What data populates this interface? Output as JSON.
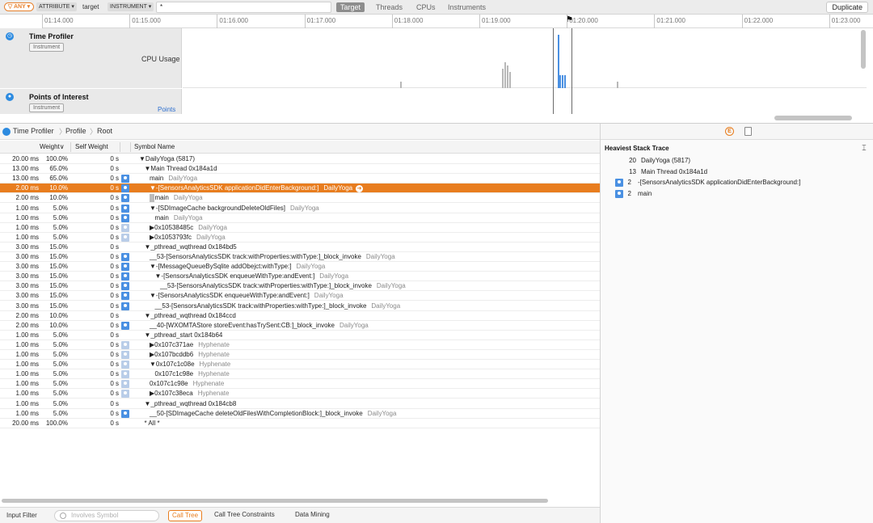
{
  "filterbar": {
    "any_label": "▽ ANY ▾",
    "token1": "ATTRIBUTE ▾",
    "token1_value": "target",
    "token2": "INSTRUMENT ▾",
    "token2_value": "*",
    "scopes": [
      "Target",
      "Threads",
      "CPUs",
      "Instruments"
    ],
    "active_scope": "Target",
    "duplicate_label": "Duplicate"
  },
  "ruler": {
    "ticks": [
      "01:14.000",
      "01:15.000",
      "01:16.000",
      "01:17.000",
      "01:18.000",
      "01:19.000",
      "01:20.000",
      "01:21.000",
      "01:22.000",
      "01:23.000"
    ]
  },
  "tracks": [
    {
      "title": "Time Profiler",
      "badge": "Instrument",
      "sub": "CPU Usage",
      "icon": "time-profiler-icon"
    },
    {
      "title": "Points of Interest",
      "badge": "Instrument",
      "sub": "Points",
      "icon": "poi-icon"
    }
  ],
  "breadcrumb": [
    "Time Profiler",
    "Profile",
    "Root"
  ],
  "columns": {
    "weight": "Weight∨",
    "self": "Self Weight",
    "symbol": "Symbol Name"
  },
  "rows": [
    {
      "w": "20.00 ms",
      "p": "100.0%",
      "s": "0 s",
      "ic": "",
      "d": 0,
      "sym": "▼DailyYoga (5817)",
      "lib": ""
    },
    {
      "w": "13.00 ms",
      "p": "65.0%",
      "s": "0 s",
      "ic": "",
      "d": 1,
      "sym": "▼Main Thread  0x184a1d",
      "lib": ""
    },
    {
      "w": "13.00 ms",
      "p": "65.0%",
      "s": "0 s",
      "ic": "u",
      "d": 2,
      "sym": "main",
      "lib": "DailyYoga"
    },
    {
      "w": "2.00 ms",
      "p": "10.0%",
      "s": "0 s",
      "ic": "u",
      "d": 2,
      "sym": "▼-[SensorsAnalyticsSDK applicationDidEnterBackground:]",
      "lib": "DailyYoga",
      "sel": true
    },
    {
      "w": "2.00 ms",
      "p": "10.0%",
      "s": "0 s",
      "ic": "u",
      "d": 3,
      "sym": "main",
      "lib": "DailyYoga",
      "gray": true
    },
    {
      "w": "1.00 ms",
      "p": "5.0%",
      "s": "0 s",
      "ic": "u",
      "d": 2,
      "sym": "▼-[SDImageCache backgroundDeleteOldFiles]",
      "lib": "DailyYoga"
    },
    {
      "w": "1.00 ms",
      "p": "5.0%",
      "s": "0 s",
      "ic": "u",
      "d": 3,
      "sym": "main",
      "lib": "DailyYoga"
    },
    {
      "w": "1.00 ms",
      "p": "5.0%",
      "s": "0 s",
      "ic": "g",
      "d": 2,
      "sym": "▶0x10538485c",
      "lib": "DailyYoga"
    },
    {
      "w": "1.00 ms",
      "p": "5.0%",
      "s": "0 s",
      "ic": "g",
      "d": 2,
      "sym": "▶0x1053793fc",
      "lib": "DailyYoga"
    },
    {
      "w": "3.00 ms",
      "p": "15.0%",
      "s": "0 s",
      "ic": "",
      "d": 1,
      "sym": "▼_pthread_wqthread  0x184bd5",
      "lib": ""
    },
    {
      "w": "3.00 ms",
      "p": "15.0%",
      "s": "0 s",
      "ic": "u",
      "d": 2,
      "sym": "__53-[SensorsAnalyticsSDK track:withProperties:withType:]_block_invoke",
      "lib": "DailyYoga"
    },
    {
      "w": "3.00 ms",
      "p": "15.0%",
      "s": "0 s",
      "ic": "u",
      "d": 2,
      "sym": "▼-[MessageQueueBySqlite addObejct:withType:]",
      "lib": "DailyYoga"
    },
    {
      "w": "3.00 ms",
      "p": "15.0%",
      "s": "0 s",
      "ic": "u",
      "d": 3,
      "sym": "▼-[SensorsAnalyticsSDK enqueueWithType:andEvent:]",
      "lib": "DailyYoga"
    },
    {
      "w": "3.00 ms",
      "p": "15.0%",
      "s": "0 s",
      "ic": "u",
      "d": 4,
      "sym": "__53-[SensorsAnalyticsSDK track:withProperties:withType:]_block_invoke",
      "lib": "DailyYoga"
    },
    {
      "w": "3.00 ms",
      "p": "15.0%",
      "s": "0 s",
      "ic": "u",
      "d": 2,
      "sym": "▼-[SensorsAnalyticsSDK enqueueWithType:andEvent:]",
      "lib": "DailyYoga"
    },
    {
      "w": "3.00 ms",
      "p": "15.0%",
      "s": "0 s",
      "ic": "u",
      "d": 3,
      "sym": "__53-[SensorsAnalyticsSDK track:withProperties:withType:]_block_invoke",
      "lib": "DailyYoga"
    },
    {
      "w": "2.00 ms",
      "p": "10.0%",
      "s": "0 s",
      "ic": "",
      "d": 1,
      "sym": "▼_pthread_wqthread  0x184ccd",
      "lib": ""
    },
    {
      "w": "2.00 ms",
      "p": "10.0%",
      "s": "0 s",
      "ic": "u",
      "d": 2,
      "sym": "__40-[WXOMTAStore storeEvent:hasTrySent:CB:]_block_invoke",
      "lib": "DailyYoga"
    },
    {
      "w": "1.00 ms",
      "p": "5.0%",
      "s": "0 s",
      "ic": "",
      "d": 1,
      "sym": "▼_pthread_start  0x184b64",
      "lib": ""
    },
    {
      "w": "1.00 ms",
      "p": "5.0%",
      "s": "0 s",
      "ic": "g",
      "d": 2,
      "sym": "▶0x107c371ae",
      "lib": "Hyphenate"
    },
    {
      "w": "1.00 ms",
      "p": "5.0%",
      "s": "0 s",
      "ic": "g",
      "d": 2,
      "sym": "▶0x107bcddb6",
      "lib": "Hyphenate"
    },
    {
      "w": "1.00 ms",
      "p": "5.0%",
      "s": "0 s",
      "ic": "g",
      "d": 2,
      "sym": "▼0x107c1c08e",
      "lib": "Hyphenate"
    },
    {
      "w": "1.00 ms",
      "p": "5.0%",
      "s": "0 s",
      "ic": "g",
      "d": 3,
      "sym": "0x107c1c98e",
      "lib": "Hyphenate"
    },
    {
      "w": "1.00 ms",
      "p": "5.0%",
      "s": "0 s",
      "ic": "g",
      "d": 2,
      "sym": "0x107c1c98e",
      "lib": "Hyphenate"
    },
    {
      "w": "1.00 ms",
      "p": "5.0%",
      "s": "0 s",
      "ic": "g",
      "d": 2,
      "sym": "▶0x107c38eca",
      "lib": "Hyphenate"
    },
    {
      "w": "1.00 ms",
      "p": "5.0%",
      "s": "0 s",
      "ic": "",
      "d": 1,
      "sym": "▼_pthread_wqthread  0x184cb8",
      "lib": ""
    },
    {
      "w": "1.00 ms",
      "p": "5.0%",
      "s": "0 s",
      "ic": "u",
      "d": 2,
      "sym": "__50-[SDImageCache deleteOldFilesWithCompletionBlock:]_block_invoke",
      "lib": "DailyYoga"
    },
    {
      "w": "20.00 ms",
      "p": "100.0%",
      "s": "0 s",
      "ic": "",
      "d": 1,
      "sym": "* All *",
      "lib": ""
    }
  ],
  "footer": {
    "input_filter": "Input Filter",
    "involves_placeholder": "Involves Symbol",
    "call_tree": "Call Tree",
    "constraints": "Call Tree Constraints",
    "data_mining": "Data Mining"
  },
  "rightpanel": {
    "title": "Heaviest Stack Trace",
    "stack": [
      {
        "n": "20",
        "sym": "DailyYoga (5817)",
        "ic": false
      },
      {
        "n": "13",
        "sym": "Main Thread  0x184a1d",
        "ic": false
      },
      {
        "n": "2",
        "sym": "-[SensorsAnalyticsSDK applicationDidEnterBackground:]",
        "ic": true
      },
      {
        "n": "2",
        "sym": "main",
        "ic": true
      }
    ]
  },
  "colors": {
    "accent": "#e87d1e",
    "blue": "#4a90e2",
    "cpu_gray": "#b8b8b8"
  }
}
